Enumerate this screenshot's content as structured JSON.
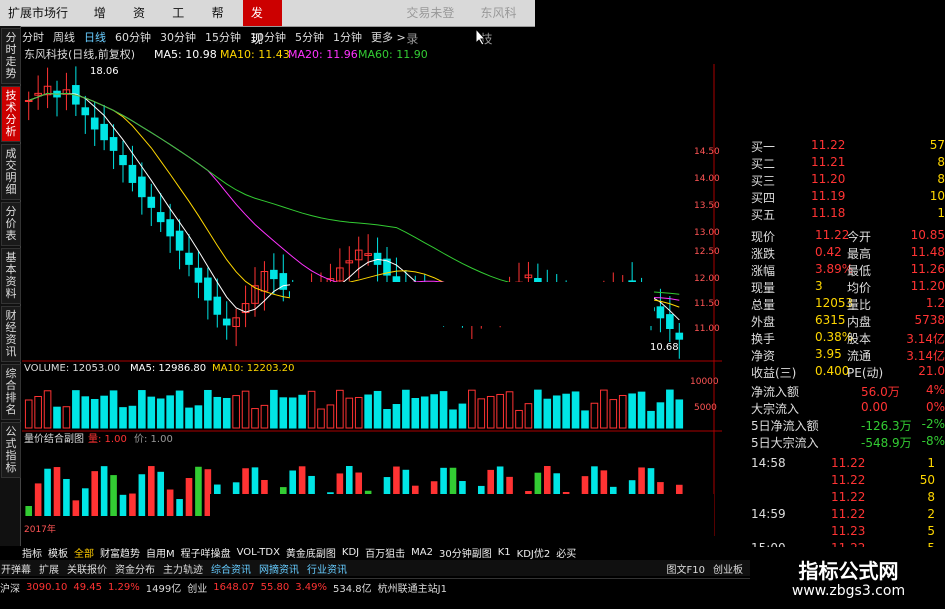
{
  "menu": {
    "items": [
      "扩展市场行情",
      "增强",
      "资讯",
      "工具",
      "帮助"
    ],
    "active": "发现",
    "ghost_items": [
      "交易未登录",
      "东风科技"
    ]
  },
  "left_tabs": [
    "分时走势",
    "技术分析",
    "成交明细",
    "分价表",
    "基本资料",
    "财经资讯",
    "综合排名",
    "公式指标"
  ],
  "periods": [
    "分时",
    "周线",
    "日线",
    "60分钟",
    "30分钟",
    "15分钟",
    "10分钟",
    "5分钟",
    "1分钟",
    "更多 >"
  ],
  "period_selected": "日线",
  "chart_header": {
    "stock": "东风科技(日线,前复权)",
    "ma5": "MA5: 10.98",
    "ma10": "MA10: 11.43",
    "ma20": "MA20: 11.96",
    "ma60": "MA60: 11.90",
    "high_label": "18.06",
    "low_label": "10.68"
  },
  "price_axis": [
    "14.50",
    "14.00",
    "13.50",
    "13.00",
    "12.50",
    "12.00",
    "11.50",
    "11.00"
  ],
  "volume_header": {
    "volume": "VOLUME: 12053.00",
    "ma5": "MA5: 12986.80",
    "ma10": "MA10: 12203.20"
  },
  "volume_axis": [
    "10000",
    "5000",
    "10000"
  ],
  "indicator_header": {
    "name": "量价结合副图",
    "v1": "量: 1.00",
    "v2": "价: 1.00"
  },
  "year_label": "2017年",
  "order_book": [
    {
      "label": "买一",
      "price": "11.22",
      "vol": "57"
    },
    {
      "label": "买二",
      "price": "11.21",
      "vol": "8"
    },
    {
      "label": "买三",
      "price": "11.20",
      "vol": "8"
    },
    {
      "label": "买四",
      "price": "11.19",
      "vol": "10"
    },
    {
      "label": "买五",
      "price": "11.18",
      "vol": "1"
    }
  ],
  "quote": [
    {
      "l1": "现价",
      "v1": "11.22",
      "l2": "今开",
      "v2": "10.85"
    },
    {
      "l1": "涨跌",
      "v1": "0.42",
      "l2": "最高",
      "v2": "11.48"
    },
    {
      "l1": "涨幅",
      "v1": "3.89%",
      "l2": "最低",
      "v2": "11.26"
    },
    {
      "l1": "现量",
      "v1": "3",
      "l2": "均价",
      "v2": "11.20"
    },
    {
      "l1": "总量",
      "v1": "12053",
      "l2": "量比",
      "v2": "1.2"
    },
    {
      "l1": "外盘",
      "v1": "6315",
      "l2": "内盘",
      "v2": "5738"
    },
    {
      "l1": "换手",
      "v1": "0.38%",
      "l2": "股本",
      "v2": "3.14亿"
    },
    {
      "l1": "净资",
      "v1": "3.95",
      "l2": "流通",
      "v2": "3.14亿"
    },
    {
      "l1": "收益(三)",
      "v1": "0.400",
      "l2": "PE(动)",
      "v2": "21.0"
    }
  ],
  "flows": [
    {
      "label": "净流入额",
      "value": "56.0万",
      "pct": "4%"
    },
    {
      "label": "大宗流入",
      "value": "0.00",
      "pct": "0%"
    },
    {
      "label": "5日净流入额",
      "value": "-126.3万",
      "pct": "-2%"
    },
    {
      "label": "5日大宗流入",
      "value": "-548.9万",
      "pct": "-8%"
    }
  ],
  "ticks": [
    {
      "time": "14:58",
      "price": "11.22",
      "vol": "1"
    },
    {
      "time": "",
      "price": "11.22",
      "vol": "50"
    },
    {
      "time": "",
      "price": "11.22",
      "vol": "8"
    },
    {
      "time": "14:59",
      "price": "11.22",
      "vol": "2"
    },
    {
      "time": "",
      "price": "11.23",
      "vol": "5"
    },
    {
      "time": "15:00",
      "price": "11.22",
      "vol": "5"
    }
  ],
  "bottom_tabs": [
    "指标",
    "模板",
    "全部",
    "财富趋势",
    "自用M",
    "程子咩操盘",
    "VOL-TDX",
    "黄金底副图",
    "KDJ",
    "百万狙击",
    "MA2",
    "30分钟副图",
    "K1",
    "KDJ优2",
    "必买"
  ],
  "bottom_tab_selected": "全部",
  "links": [
    "开弹幕",
    "扩展",
    "关联报价",
    "资金分布",
    "主力轨迹",
    "综合资讯",
    "网摘资讯",
    "行业资讯"
  ],
  "links_right": [
    "图文F10",
    "创业板"
  ],
  "status": {
    "sh_label": "沪深",
    "sh_value": "3090.10",
    "sh_change": "49.45",
    "sh_pct": "1.29%",
    "sh_amount": "1499亿",
    "cy_label": "创业",
    "cy_value": "1648.07",
    "cy_change": "55.80",
    "cy_pct": "3.49%",
    "cy_amount": "534.8亿",
    "server": "杭州联通主站J1"
  },
  "watermark": {
    "title": "指标公式网",
    "url": "www.zbgs3.com"
  },
  "colors": {
    "up": "#ff3333",
    "down": "#00e5e5",
    "ma5": "#ffffff",
    "ma10": "#ffd700",
    "ma20": "#ff33ff",
    "ma60": "#33cc33",
    "label": "#ffffff"
  },
  "chart_data": {
    "type": "candlestick",
    "ylim": [
      10.5,
      18.5
    ],
    "ohlc_note": "approximate daily candles read from chart"
  }
}
